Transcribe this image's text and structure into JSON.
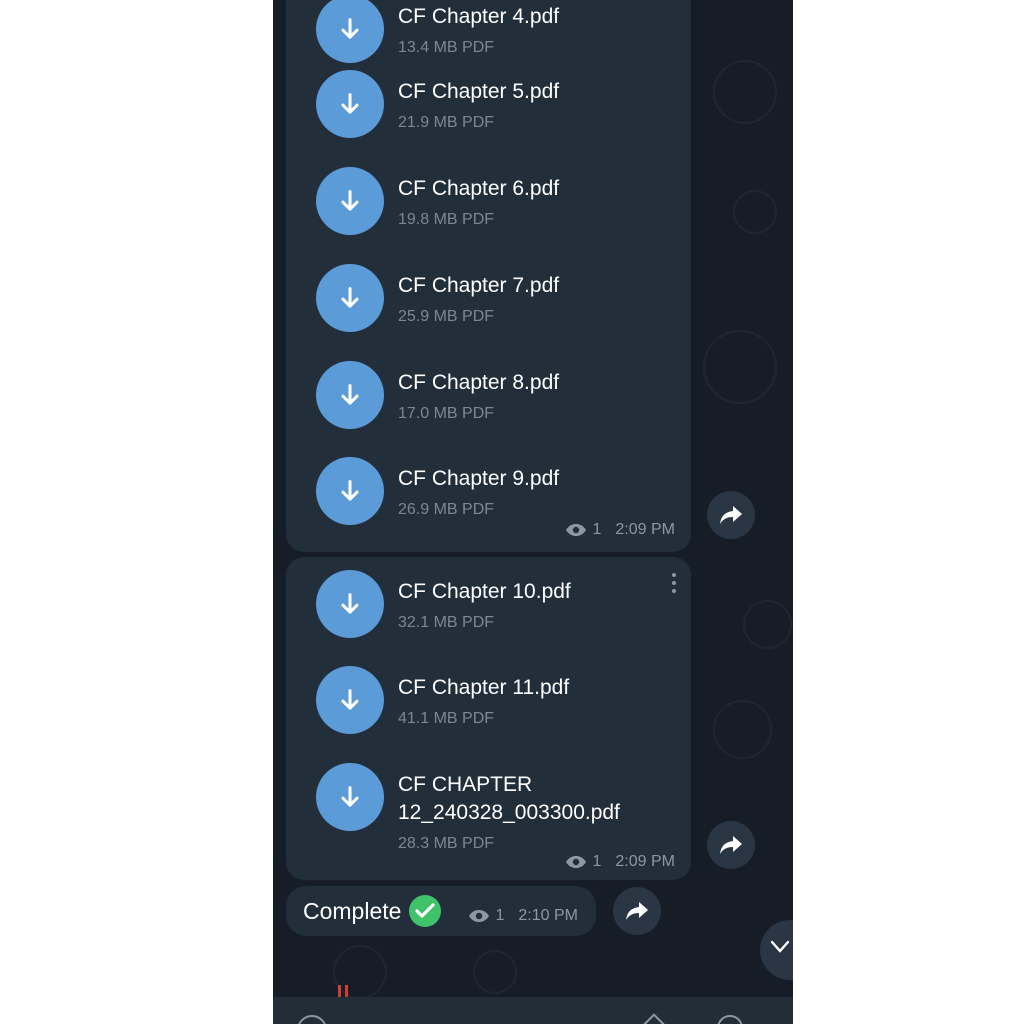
{
  "files": [
    {
      "name": "CF Chapter 4.pdf",
      "size": "13.4 MB PDF"
    },
    {
      "name": "CF Chapter 5.pdf",
      "size": "21.9 MB PDF"
    },
    {
      "name": "CF Chapter 6.pdf",
      "size": "19.8 MB PDF"
    },
    {
      "name": "CF Chapter 7.pdf",
      "size": "25.9 MB PDF"
    },
    {
      "name": "CF Chapter 8.pdf",
      "size": "17.0 MB PDF"
    },
    {
      "name": "CF Chapter 9.pdf",
      "size": "26.9 MB PDF"
    },
    {
      "name": "CF Chapter 10.pdf",
      "size": "32.1 MB PDF"
    },
    {
      "name": "CF Chapter 11.pdf",
      "size": "41.1 MB PDF"
    },
    {
      "name": "CF CHAPTER 12_240328_003300.pdf",
      "size": "28.3 MB PDF"
    }
  ],
  "message_groups": [
    {
      "views": "1",
      "time": "2:09 PM"
    },
    {
      "views": "1",
      "time": "2:09 PM"
    }
  ],
  "text_message": {
    "text": "Complete",
    "views": "1",
    "time": "2:10 PM"
  },
  "icons": {
    "download": "arrow-down-icon",
    "forward": "forward-arrow-icon",
    "views": "eye-icon",
    "menu": "more-vertical-icon",
    "check": "check-icon"
  },
  "colors": {
    "background": "#161d26",
    "bubble": "#222e3a",
    "download_button": "#5a9bd8",
    "check": "#3fc26a"
  }
}
